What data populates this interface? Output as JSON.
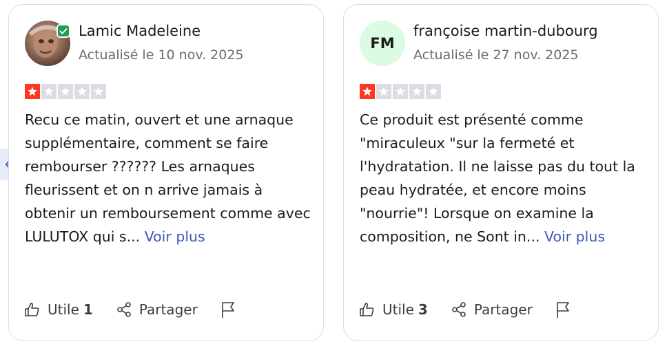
{
  "reviews": [
    {
      "name": "Lamic Madeleine",
      "date": "Actualisé le 10 nov. 2025",
      "rating": 1,
      "max_rating": 5,
      "text": "Recu ce matin, ouvert et une arnaque supplémentaire, comment se faire rembourser ?????? Les arnaques fleurissent et on n arrive jamais à obtenir un remboursement comme avec LULUTOX qui s...",
      "more_label": "Voir plus",
      "useful_label": "Utile",
      "useful_count": "1",
      "share_label": "Partager",
      "verified": true,
      "avatar_icon": "user-photo-icon"
    },
    {
      "name": "françoise martin-dubourg",
      "initials": "FM",
      "date": "Actualisé le 27 nov. 2025",
      "rating": 1,
      "max_rating": 5,
      "text": "Ce produit est présenté comme \"miraculeux \"sur la fermeté et l'hydratation. Il ne laisse pas du tout la peau hydratée, et encore moins \"nourrie\"! Lorsque on examine la composition, ne Sont in...",
      "more_label": "Voir plus",
      "useful_label": "Utile",
      "useful_count": "3",
      "share_label": "Partager"
    }
  ],
  "colors": {
    "star_on": "#ff3722",
    "star_off": "#dcdce6",
    "link": "#3c57bc",
    "verified": "#1f9d55",
    "initials_bg": "#dbfbe3"
  }
}
